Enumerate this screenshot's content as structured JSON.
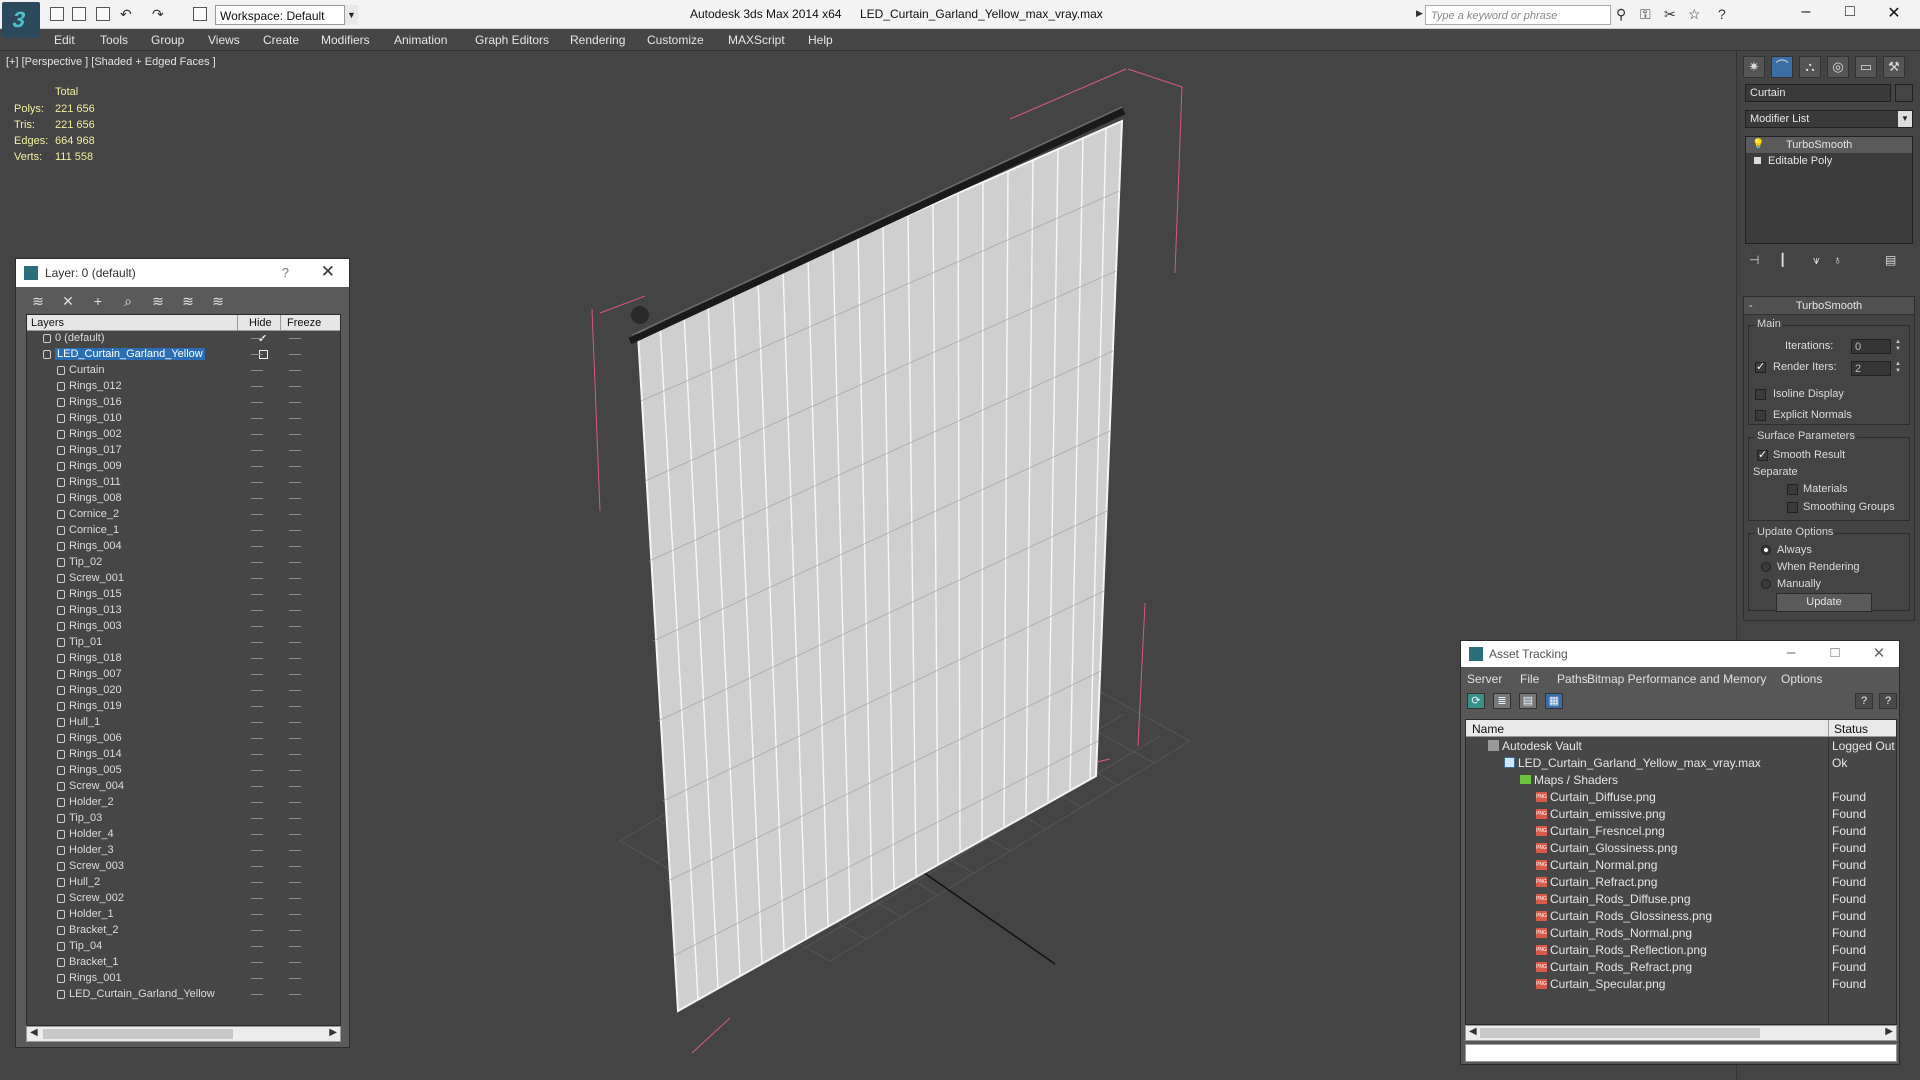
{
  "titlebar": {
    "workspace": "Workspace: Default",
    "app_name": "Autodesk 3ds Max  2014 x64",
    "file_name": "LED_Curtain_Garland_Yellow_max_vray.max",
    "search_placeholder": "Type a keyword or phrase"
  },
  "menu": [
    "Edit",
    "Tools",
    "Group",
    "Views",
    "Create",
    "Modifiers",
    "Animation",
    "Graph Editors",
    "Rendering",
    "Customize",
    "MAXScript",
    "Help"
  ],
  "viewport": {
    "label": "[+] [Perspective ] [Shaded + Edged Faces ]",
    "stats": {
      "total_label": "Total",
      "rows": [
        {
          "label": "Polys:",
          "value": "221 656"
        },
        {
          "label": "Tris:",
          "value": "221 656"
        },
        {
          "label": "Edges:",
          "value": "664 968"
        },
        {
          "label": "Verts:",
          "value": "111 558"
        }
      ]
    }
  },
  "layer_dialog": {
    "title": "Layer: 0 (default)",
    "help": "?",
    "close": "✕",
    "columns": {
      "layers": "Layers",
      "hide": "Hide",
      "freeze": "Freeze"
    },
    "layers": [
      {
        "name": "0 (default)",
        "level": 0
      },
      {
        "name": "LED_Curtain_Garland_Yellow",
        "level": 0
      },
      {
        "name": "Curtain",
        "level": 1
      },
      {
        "name": "Rings_012",
        "level": 1
      },
      {
        "name": "Rings_016",
        "level": 1
      },
      {
        "name": "Rings_010",
        "level": 1
      },
      {
        "name": "Rings_002",
        "level": 1
      },
      {
        "name": "Rings_017",
        "level": 1
      },
      {
        "name": "Rings_009",
        "level": 1
      },
      {
        "name": "Rings_011",
        "level": 1
      },
      {
        "name": "Rings_008",
        "level": 1
      },
      {
        "name": "Cornice_2",
        "level": 1
      },
      {
        "name": "Cornice_1",
        "level": 1
      },
      {
        "name": "Rings_004",
        "level": 1
      },
      {
        "name": "Tip_02",
        "level": 1
      },
      {
        "name": "Screw_001",
        "level": 1
      },
      {
        "name": "Rings_015",
        "level": 1
      },
      {
        "name": "Rings_013",
        "level": 1
      },
      {
        "name": "Rings_003",
        "level": 1
      },
      {
        "name": "Tip_01",
        "level": 1
      },
      {
        "name": "Rings_018",
        "level": 1
      },
      {
        "name": "Rings_007",
        "level": 1
      },
      {
        "name": "Rings_020",
        "level": 1
      },
      {
        "name": "Rings_019",
        "level": 1
      },
      {
        "name": "Hull_1",
        "level": 1
      },
      {
        "name": "Rings_006",
        "level": 1
      },
      {
        "name": "Rings_014",
        "level": 1
      },
      {
        "name": "Rings_005",
        "level": 1
      },
      {
        "name": "Screw_004",
        "level": 1
      },
      {
        "name": "Holder_2",
        "level": 1
      },
      {
        "name": "Tip_03",
        "level": 1
      },
      {
        "name": "Holder_4",
        "level": 1
      },
      {
        "name": "Holder_3",
        "level": 1
      },
      {
        "name": "Screw_003",
        "level": 1
      },
      {
        "name": "Hull_2",
        "level": 1
      },
      {
        "name": "Screw_002",
        "level": 1
      },
      {
        "name": "Holder_1",
        "level": 1
      },
      {
        "name": "Bracket_2",
        "level": 1
      },
      {
        "name": "Tip_04",
        "level": 1
      },
      {
        "name": "Bracket_1",
        "level": 1
      },
      {
        "name": "Rings_001",
        "level": 1
      },
      {
        "name": "LED_Curtain_Garland_Yellow",
        "level": 1
      }
    ]
  },
  "command_panel": {
    "object_name": "Curtain",
    "modifier_list": "Modifier List",
    "stack": [
      "TurboSmooth",
      "Editable Poly"
    ],
    "turbosmooth": {
      "header": "TurboSmooth",
      "minus": "-",
      "main_group": "Main",
      "iterations_label": "Iterations:",
      "iterations_value": "0",
      "render_iters_label": "Render Iters:",
      "render_iters_value": "2",
      "isoline_label": "Isoline Display",
      "explicit_label": "Explicit Normals",
      "surface_group": "Surface Parameters",
      "smooth_result_label": "Smooth Result",
      "separate_label": "Separate",
      "materials_label": "Materials",
      "smoothing_groups_label": "Smoothing Groups",
      "update_group": "Update Options",
      "always_label": "Always",
      "when_rendering_label": "When Rendering",
      "manually_label": "Manually",
      "update_button": "Update"
    }
  },
  "asset_tracking": {
    "title": "Asset Tracking",
    "menu": [
      "Server",
      "File",
      "Paths",
      "Bitmap Performance and Memory",
      "Options"
    ],
    "columns": {
      "name": "Name",
      "status": "Status"
    },
    "rows": [
      {
        "name": "Autodesk Vault",
        "status": "Logged Out",
        "level": 0,
        "icon": "vault"
      },
      {
        "name": "LED_Curtain_Garland_Yellow_max_vray.max",
        "status": "Ok",
        "level": 1,
        "icon": "file"
      },
      {
        "name": "Maps / Shaders",
        "status": "",
        "level": 2,
        "icon": "folder"
      },
      {
        "name": "Curtain_Diffuse.png",
        "status": "Found",
        "level": 3,
        "icon": "png"
      },
      {
        "name": "Curtain_emissive.png",
        "status": "Found",
        "level": 3,
        "icon": "png"
      },
      {
        "name": "Curtain_Fresncel.png",
        "status": "Found",
        "level": 3,
        "icon": "png"
      },
      {
        "name": "Curtain_Glossiness.png",
        "status": "Found",
        "level": 3,
        "icon": "png"
      },
      {
        "name": "Curtain_Normal.png",
        "status": "Found",
        "level": 3,
        "icon": "png"
      },
      {
        "name": "Curtain_Refract.png",
        "status": "Found",
        "level": 3,
        "icon": "png"
      },
      {
        "name": "Curtain_Rods_Diffuse.png",
        "status": "Found",
        "level": 3,
        "icon": "png"
      },
      {
        "name": "Curtain_Rods_Glossiness.png",
        "status": "Found",
        "level": 3,
        "icon": "png"
      },
      {
        "name": "Curtain_Rods_Normal.png",
        "status": "Found",
        "level": 3,
        "icon": "png"
      },
      {
        "name": "Curtain_Rods_Reflection.png",
        "status": "Found",
        "level": 3,
        "icon": "png"
      },
      {
        "name": "Curtain_Rods_Refract.png",
        "status": "Found",
        "level": 3,
        "icon": "png"
      },
      {
        "name": "Curtain_Specular.png",
        "status": "Found",
        "level": 3,
        "icon": "png"
      }
    ]
  }
}
